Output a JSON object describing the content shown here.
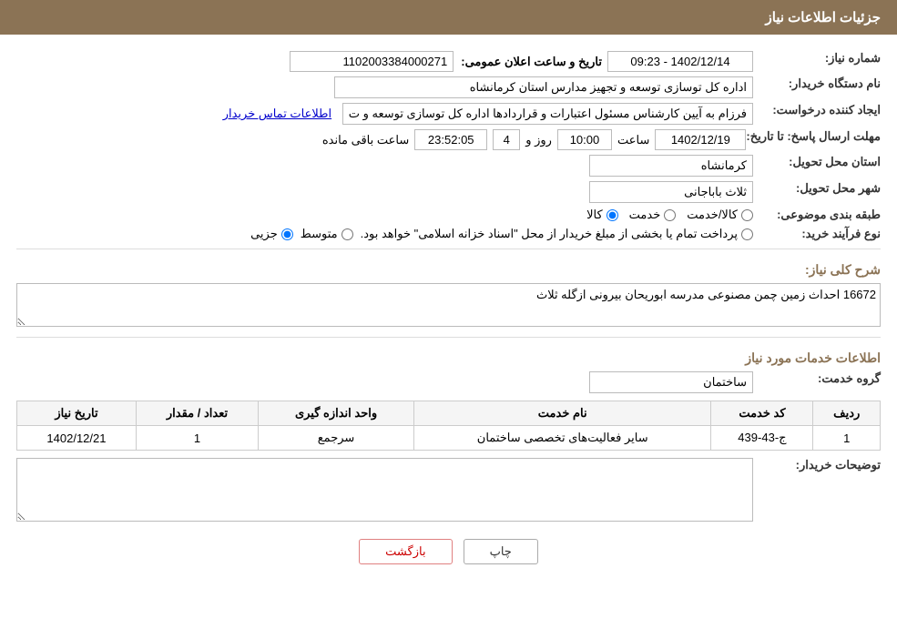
{
  "header": {
    "title": "جزئیات اطلاعات نیاز"
  },
  "labels": {
    "need_number": "شماره نیاز:",
    "buyer_org": "نام دستگاه خریدار:",
    "requester": "ایجاد کننده درخواست:",
    "deadline": "مهلت ارسال پاسخ: تا تاریخ:",
    "province": "استان محل تحویل:",
    "city": "شهر محل تحویل:",
    "category": "طبقه بندی موضوعی:",
    "purchase_type": "نوع فرآیند خرید:",
    "description_label": "شرح کلی نیاز:",
    "services_title": "اطلاعات خدمات مورد نیاز",
    "service_group": "گروه خدمت:",
    "buyer_notes": "توضیحات خریدار:",
    "announce_datetime": "تاریخ و ساعت اعلان عمومی:"
  },
  "values": {
    "need_number": "1102003384000271",
    "buyer_org": "اداره کل توسازی  توسعه و تجهیز مدارس استان کرمانشاه",
    "requester": "فرزام به آیین کارشناس مسئول اعتبارات و قراردادها اداره کل توسازی  توسعه و ت",
    "requester_link": "اطلاعات تماس خریدار",
    "deadline_date": "1402/12/19",
    "deadline_time": "10:00",
    "deadline_days": "4",
    "deadline_countdown": "23:52:05",
    "deadline_suffix": "ساعت باقی مانده",
    "announce_date": "1402/12/14 - 09:23",
    "province": "کرمانشاه",
    "city": "ثلاث باباجانی",
    "category_options": [
      "کالا",
      "خدمت",
      "کالا/خدمت"
    ],
    "category_selected": "کالا",
    "purchase_type_options": [
      "جزیی",
      "متوسط",
      "پرداخت تمام یا بخشی از مبلغ خریدار از محل \"اسناد خزانه اسلامی\" خواهد بود."
    ],
    "purchase_type_selected": "جزیی",
    "purchase_note": "پرداخت تمام یا بخشی از مبلغ خریدار از محل \"اسناد خزانه اسلامی\" خواهد بود.",
    "description_text": "16672 احداث زمین چمن مصنوعی مدرسه ابوریحان بیرونی ازگله ثلاث",
    "service_group": "ساختمان",
    "table_headers": [
      "ردیف",
      "کد خدمت",
      "نام خدمت",
      "واحد اندازه گیری",
      "تعداد / مقدار",
      "تاریخ نیاز"
    ],
    "table_rows": [
      {
        "row": "1",
        "code": "ج-43-439",
        "name": "سایر فعالیت‌های تخصصی ساختمان",
        "unit": "سرجمع",
        "quantity": "1",
        "date": "1402/12/21"
      }
    ]
  },
  "buttons": {
    "print": "چاپ",
    "back": "بازگشت"
  }
}
